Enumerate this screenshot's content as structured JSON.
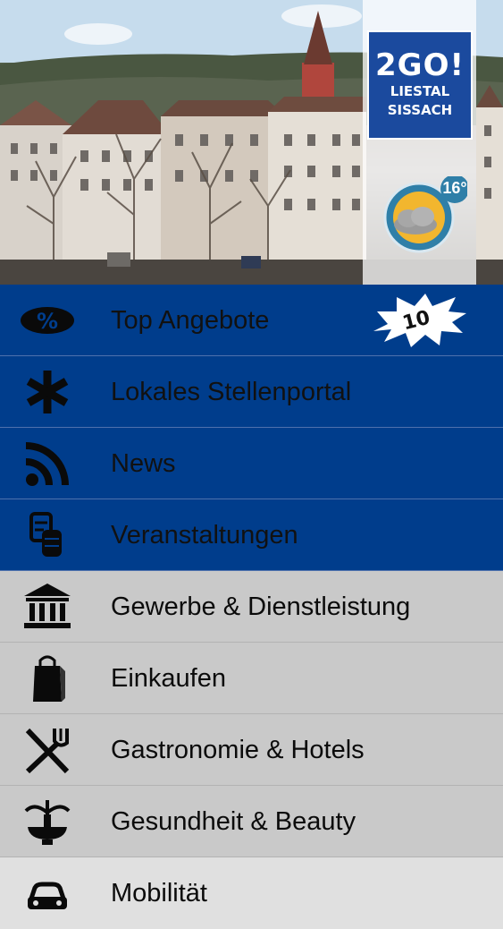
{
  "header": {
    "logo_main": "2GO!",
    "logo_line1": "LIESTAL",
    "logo_line2": "SISSACH",
    "weather_temp": "16°",
    "weather_icon": "sun-cloud-icon"
  },
  "menu": {
    "items": [
      {
        "label": "Top Angebote",
        "icon": "percent-tag-icon",
        "badge": "10"
      },
      {
        "label": "Lokales Stellenportal",
        "icon": "asterisk-icon"
      },
      {
        "label": "News",
        "icon": "rss-icon"
      },
      {
        "label": "Veranstaltungen",
        "icon": "events-icon"
      },
      {
        "label": "Gewerbe & Dienstleistung",
        "icon": "building-icon"
      },
      {
        "label": "Einkaufen",
        "icon": "shopping-bag-icon"
      },
      {
        "label": "Gastronomie & Hotels",
        "icon": "fork-knife-icon"
      },
      {
        "label": "Gesundheit & Beauty",
        "icon": "fountain-icon"
      },
      {
        "label": "Mobilität",
        "icon": "car-icon"
      }
    ]
  },
  "colors": {
    "primary_blue": "#003d8c",
    "logo_blue": "#1b4a9e",
    "grey": "#c9c9c9"
  }
}
